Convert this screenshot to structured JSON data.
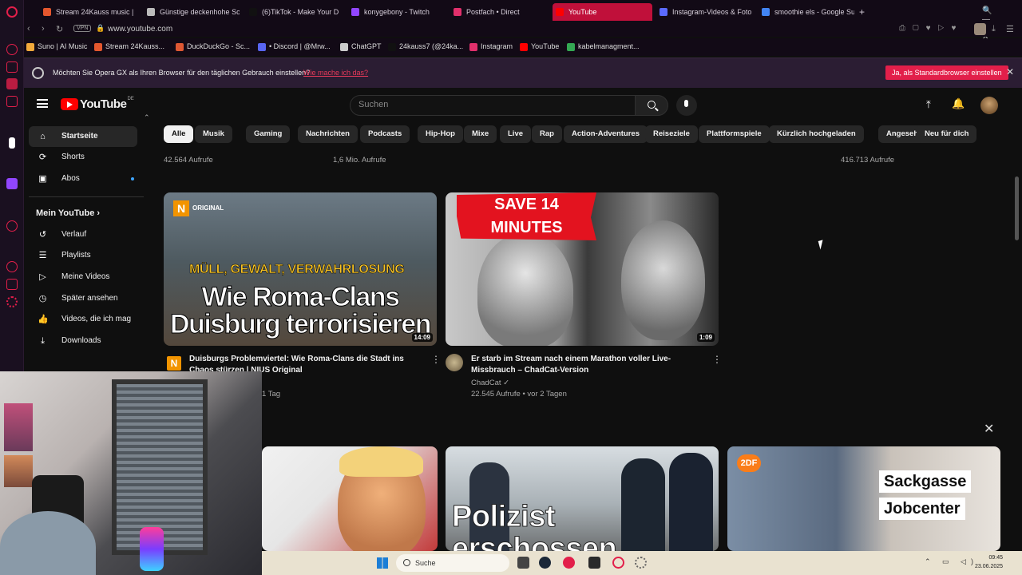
{
  "browser": {
    "tabs": [
      {
        "label": "Stream 24Kauss music | L",
        "color": "#e4572e"
      },
      {
        "label": "Günstige deckenhohe Sc",
        "color": "#bbbbbb"
      },
      {
        "label": "(6)TikTok - Make Your D",
        "color": "#111111"
      },
      {
        "label": "konygebony - Twitch",
        "color": "#9146ff"
      },
      {
        "label": "Postfach • Direct",
        "color": "#e1306c"
      },
      {
        "label": "YouTube",
        "color": "#ff0000"
      },
      {
        "label": "Instagram-Videos & Foto",
        "color": "#5b6bff"
      },
      {
        "label": "smoothie els - Google Su",
        "color": "#4285f4"
      }
    ],
    "new_tab": "+",
    "url": "www.youtube.com",
    "vpn_label": "VPN",
    "bookmarks": [
      {
        "label": "Suno | AI Music",
        "color": "#f2a93b"
      },
      {
        "label": "Stream 24Kauss...",
        "color": "#e4572e"
      },
      {
        "label": "DuckDuckGo - Sc...",
        "color": "#de5833"
      },
      {
        "label": "• Discord | @Mrw...",
        "color": "#5865f2"
      },
      {
        "label": "ChatGPT",
        "color": "#cccccc"
      },
      {
        "label": "24kauss7 (@24ka...",
        "color": "#111111"
      },
      {
        "label": "Instagram",
        "color": "#e1306c"
      },
      {
        "label": "YouTube",
        "color": "#ff0000"
      },
      {
        "label": "kabelmanagment...",
        "color": "#34a853"
      }
    ]
  },
  "banner": {
    "text": "Möchten Sie Opera GX als Ihren Browser für den täglichen Gebrauch einstellen?",
    "link": "Wie mache ich das?",
    "button": "Ja, als Standardbrowser einstellen",
    "close": "✕"
  },
  "youtube": {
    "logo": "YouTube",
    "country": "DE",
    "search_placeholder": "Suchen",
    "sidebar": {
      "top": [
        {
          "label": "Startseite",
          "icon": "⌂"
        },
        {
          "label": "Shorts",
          "icon": "⟳"
        },
        {
          "label": "Abos",
          "icon": "▣"
        }
      ],
      "section_title": "Mein YouTube",
      "section_chevron": "›",
      "items": [
        {
          "label": "Verlauf",
          "icon": "↺"
        },
        {
          "label": "Playlists",
          "icon": "☰"
        },
        {
          "label": "Meine Videos",
          "icon": "▷"
        },
        {
          "label": "Später ansehen",
          "icon": "◷"
        },
        {
          "label": "Videos, die ich mag",
          "icon": "👍"
        },
        {
          "label": "Downloads",
          "icon": "⤓"
        }
      ]
    },
    "chips": [
      "Alle",
      "Musik",
      "Gaming",
      "Nachrichten",
      "Podcasts",
      "Hip-Hop",
      "Mixe",
      "Live",
      "Rap",
      "Action-Adventures",
      "Reiseziele",
      "Plattformspiele",
      "Kürzlich hochgeladen",
      "Angesehen",
      "Neu für dich"
    ],
    "top_views": [
      "42.564 Aufrufe",
      "1,6 Mio. Aufrufe",
      "416.713 Aufrufe"
    ],
    "videos": [
      {
        "title": "Duisburgs Problemviertel: Wie Roma-Clans die Stadt ins Chaos stürzen | NIUS Original",
        "meta": "1 Tag",
        "duration": "14:09",
        "overlay_badge": "N",
        "overlay_badge_text": "ORIGINAL",
        "overlay_line1": "MÜLL, GEWALT, VERWAHRLOSUNG",
        "overlay_line2": "Wie Roma-Clans",
        "overlay_line3": "Duisburg terrorisieren"
      },
      {
        "title": "Er starb im Stream nach einem Marathon voller Live-Missbrauch – ChadCat-Version",
        "channel": "ChadCat",
        "verified": "✓",
        "meta": "22.545 Aufrufe • vor 2 Tagen",
        "duration": "1:09",
        "overlay_line1": "SAVE 14",
        "overlay_line2": "MINUTES"
      }
    ],
    "bottom_row": {
      "t4_text_line1": "Polizist",
      "t4_text_line2": "erschossen",
      "t5_badge": "2DF",
      "t5_label1": "Sackgasse",
      "t5_label2": "Jobcenter"
    },
    "close_mini": "✕"
  },
  "taskbar": {
    "search": "Suche",
    "time": "09:45",
    "date": "23.06.2025",
    "tray": "⌃ ▭ ◁)"
  }
}
